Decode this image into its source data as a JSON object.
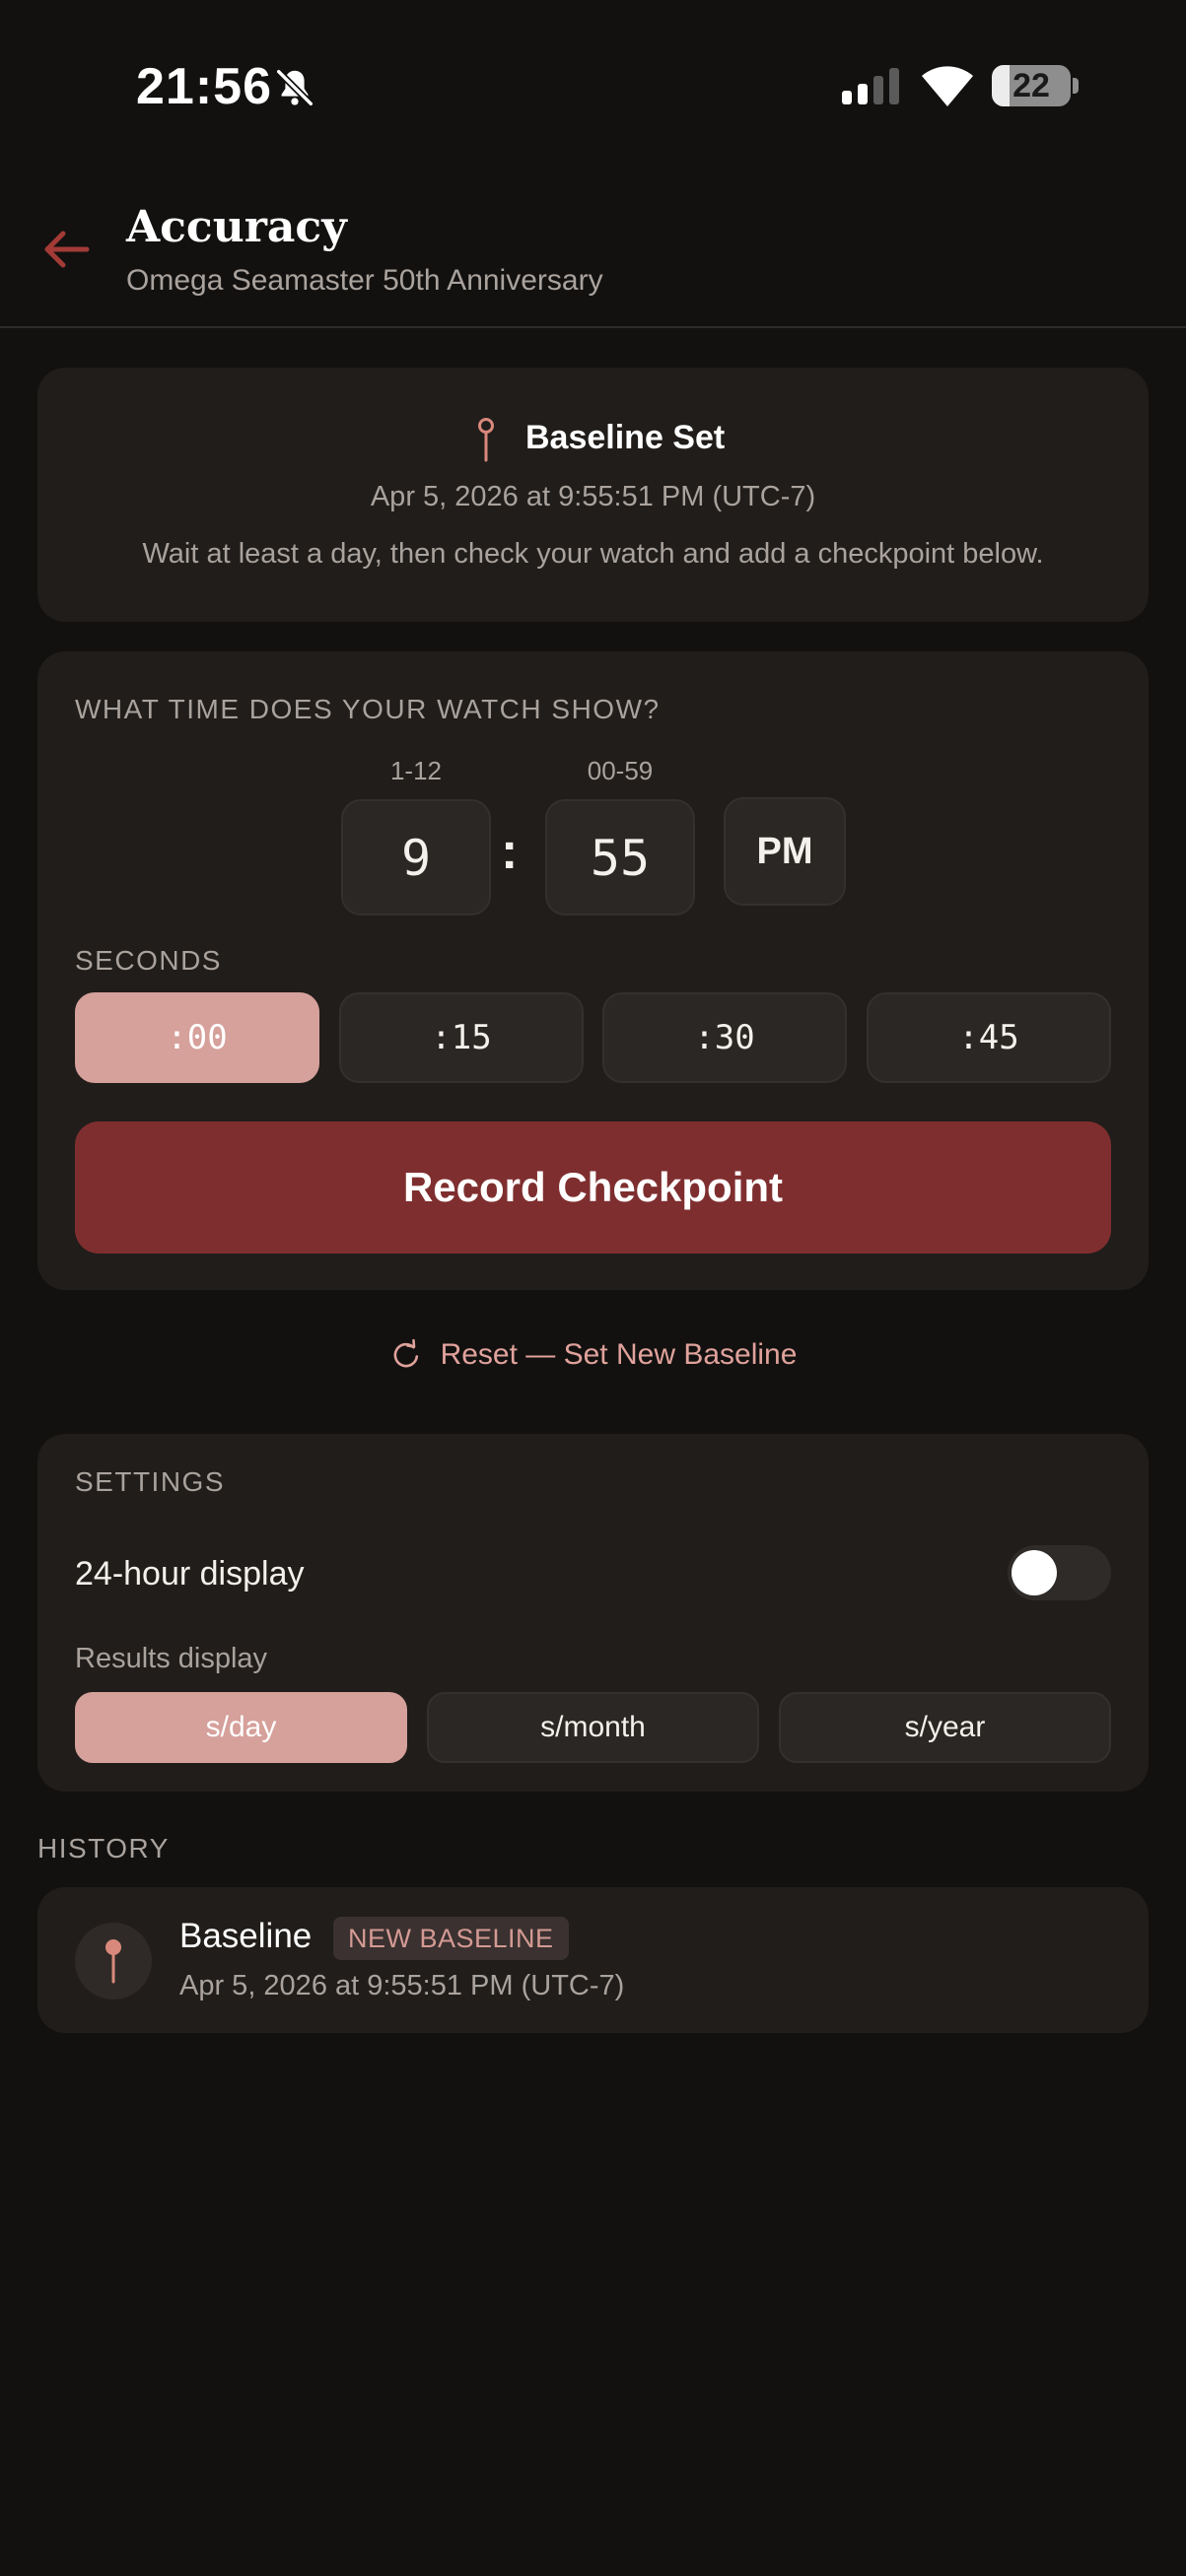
{
  "status_bar": {
    "time": "21:56",
    "battery_level": 22,
    "battery_label": "22"
  },
  "header": {
    "title": "Accuracy",
    "subtitle": "Omega Seamaster 50th Anniversary"
  },
  "baseline": {
    "title": "Baseline Set",
    "date": "Apr 5, 2026 at 9:55:51 PM (UTC-7)",
    "hint": "Wait at least a day, then check your watch and add a checkpoint below."
  },
  "time_entry": {
    "question": "WHAT TIME DOES YOUR WATCH SHOW?",
    "hour_range": "1-12",
    "minute_range": "00-59",
    "hour": "9",
    "minute": "55",
    "colon": ":",
    "ampm": "PM",
    "seconds_label": "SECONDS",
    "seconds_options": [
      ":00",
      ":15",
      ":30",
      ":45"
    ],
    "seconds_selected": ":00",
    "record_label": "Record Checkpoint"
  },
  "reset": {
    "label": "Reset — Set New Baseline"
  },
  "settings": {
    "title": "SETTINGS",
    "twentyfour_hour_label": "24-hour display",
    "twentyfour_hour_enabled": false,
    "results_label": "Results display",
    "results_options": [
      "s/day",
      "s/month",
      "s/year"
    ],
    "results_selected": "s/day"
  },
  "history": {
    "title": "HISTORY",
    "items": [
      {
        "title": "Baseline",
        "badge": "NEW BASELINE",
        "date": "Apr 5, 2026 at 9:55:51 PM (UTC-7)"
      }
    ]
  },
  "colors": {
    "background": "#121110",
    "card": "#201d1a",
    "accent_button": "#7f2e2f",
    "selected_pill": "#d6a09b",
    "link": "#e0a29b",
    "pin": "#d9897c"
  },
  "icons": {
    "back": "arrow-left-icon",
    "bell": "bell-off-icon",
    "signal": "signal-icon",
    "wifi": "wifi-icon",
    "pin": "pin-icon",
    "reset": "refresh-icon"
  }
}
